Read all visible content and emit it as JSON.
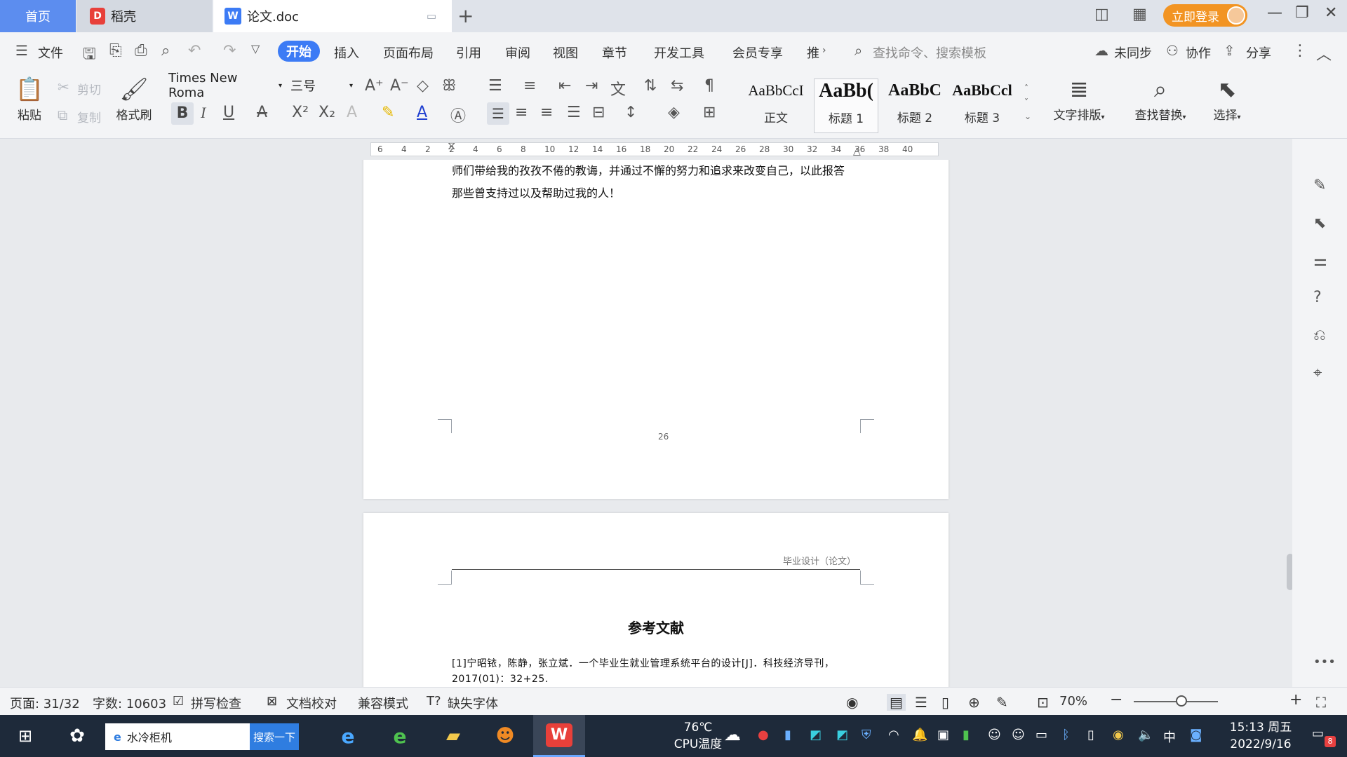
{
  "colors": {
    "accent": "#3c7bf5",
    "home_tab": "#5c8def",
    "login": "#f29423",
    "taskbar": "#1e2a3a"
  },
  "titlebar": {
    "tab_home": "首页",
    "tab_daoke": "稻壳",
    "tab_doc": "论文.doc",
    "new_tab": "+",
    "login": "立即登录"
  },
  "menubar": {
    "file": "文件",
    "items": [
      "开始",
      "插入",
      "页面布局",
      "引用",
      "审阅",
      "视图",
      "章节",
      "开发工具",
      "会员专享",
      "推"
    ],
    "search_placeholder": "查找命令、搜索模板",
    "sync": "未同步",
    "collab": "协作",
    "share": "分享"
  },
  "ribbon": {
    "paste": "粘贴",
    "cut": "剪切",
    "copy": "复制",
    "format_painter": "格式刷",
    "font_name": "Times New Roma",
    "font_size": "三号",
    "styles": [
      {
        "sample": "AaBbCcI",
        "label": "正文"
      },
      {
        "sample": "AaBb(",
        "label": "标题 1"
      },
      {
        "sample": "AaBbC",
        "label": "标题 2"
      },
      {
        "sample": "AaBbCcl",
        "label": "标题 3"
      }
    ],
    "text_layout": "文字排版",
    "find_replace": "查找替换",
    "select": "选择"
  },
  "ruler": {
    "ticks": [
      "6",
      "4",
      "2",
      "2",
      "4",
      "6",
      "8",
      "10",
      "12",
      "14",
      "16",
      "18",
      "20",
      "22",
      "24",
      "26",
      "28",
      "30",
      "32",
      "34",
      "36",
      "38",
      "40"
    ]
  },
  "document": {
    "page1_lines": [
      "师们带给我的孜孜不倦的教诲，并通过不懈的努力和追求来改变自己，以此报答",
      "那些曾支持过以及帮助过我的人！"
    ],
    "page1_number": "26",
    "page2_header": "毕业设计（论文）",
    "page2_title": "参考文献",
    "ref1": "[1]宁昭铱，陈静，张立斌．一个毕业生就业管理系统平台的设计[J]．科技经济导刊，2017(01)：32+25."
  },
  "statusbar": {
    "page": "页面: 31/32",
    "words": "字数: 10603",
    "spellcheck": "拼写检查",
    "doc_proof": "文档校对",
    "compat": "兼容模式",
    "missing_font": "缺失字体",
    "zoom": "70%"
  },
  "taskbar": {
    "search_text": "水冷柜机",
    "search_btn": "搜索一下",
    "temp": "76℃",
    "temp_label": "CPU温度",
    "ime": "中",
    "time": "15:13 周五",
    "date": "2022/9/16",
    "notif_count": "8"
  }
}
